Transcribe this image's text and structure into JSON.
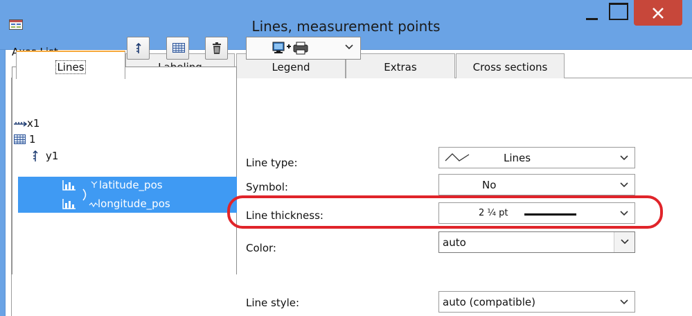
{
  "window": {
    "title": "Lines, measurement points"
  },
  "tabs": [
    {
      "label": "Lines"
    },
    {
      "label": "Labeling"
    },
    {
      "label": "Legend"
    },
    {
      "label": "Extras"
    },
    {
      "label": "Cross sections"
    }
  ],
  "axes_panel": {
    "label": "Axes List",
    "tree": {
      "x_axis": "x1",
      "group": "1",
      "y_axis": "y1",
      "series": [
        "latitude_pos",
        "longitude_pos"
      ]
    }
  },
  "properties": {
    "line_type": {
      "label": "Line type:",
      "value": "Lines"
    },
    "symbol": {
      "label": "Symbol:",
      "value": "No"
    },
    "line_thickness": {
      "label": "Line thickness:",
      "value": "2 ¼ pt"
    },
    "color": {
      "label": "Color:",
      "value": "auto"
    },
    "line_style": {
      "label": "Line style:",
      "value": "auto (compatible)"
    }
  },
  "colors": {
    "titlebar": "#6aa3e5",
    "close_button": "#c7473a",
    "selection": "#3f9af3",
    "active_tab_accent": "#f7a93b",
    "highlight": "#e0242a"
  }
}
